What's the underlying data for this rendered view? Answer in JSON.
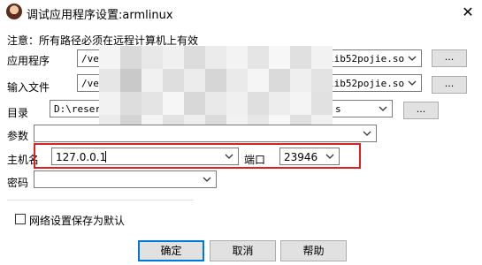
{
  "window": {
    "title": "调试应用程序设置:armlinux",
    "close_glyph": "✕"
  },
  "notice": "注意：所有路径必须在远程计算机上有效",
  "application": {
    "label": "应用程序",
    "value_start": "/ve",
    "value_end": "lib52pojie.so",
    "browse_label": "..."
  },
  "input_file": {
    "label": "输入文件",
    "value_start": "/ve",
    "value_end": "lib52pojie.so",
    "browse_label": "..."
  },
  "directory": {
    "label": "目录",
    "value_start": "D:\\reser",
    "value_end": "s",
    "browse_label": "..."
  },
  "params": {
    "label": "参数",
    "value": ""
  },
  "host": {
    "label": "主机名",
    "value": "127.0.0.1"
  },
  "port": {
    "label": "端口",
    "value": "23946"
  },
  "password": {
    "label": "密码",
    "value": ""
  },
  "save_default": {
    "label": "网络设置保存为默认",
    "checked": false
  },
  "buttons": {
    "ok": "确定",
    "cancel": "取消",
    "help": "帮助"
  },
  "colors": {
    "highlight_border": "#e02020",
    "default_button_border": "#0078d7"
  }
}
